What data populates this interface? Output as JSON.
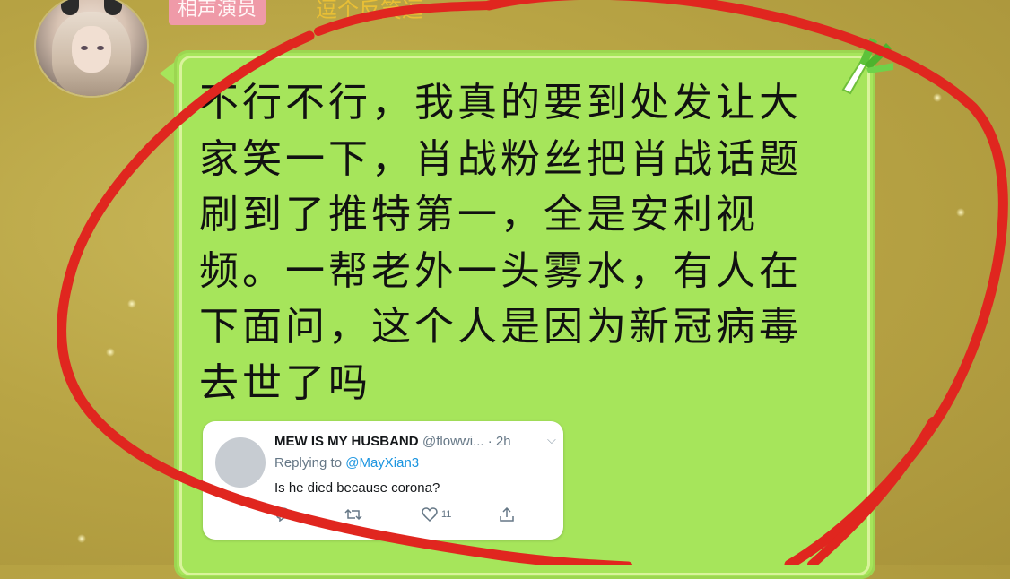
{
  "header": {
    "name_tag": "相声演员",
    "name_rest": "逗个反笑逗"
  },
  "message": {
    "text": "不行不行，我真的要到处发让大\n家笑一下，肖战粉丝把肖战话题\n刷到了推特第一，全是安利视\n频。一帮老外一头雾水，有人在\n下面问，这个人是因为新冠病毒\n去世了吗"
  },
  "tweet": {
    "display_name": "MEW IS MY HUSBAND",
    "handle_time": "@flowwi... · 2h",
    "replying_prefix": "Replying to ",
    "replying_to": "@MayXian3",
    "text": "Is he died because corona?",
    "like_count": "11",
    "chevron": "⌵",
    "icons": [
      "reply-icon",
      "retweet-icon",
      "like-icon",
      "share-icon"
    ]
  },
  "colors": {
    "bubble": "#a6e55b",
    "annotation_circle": "#e0261f",
    "background": "#b9a545"
  }
}
